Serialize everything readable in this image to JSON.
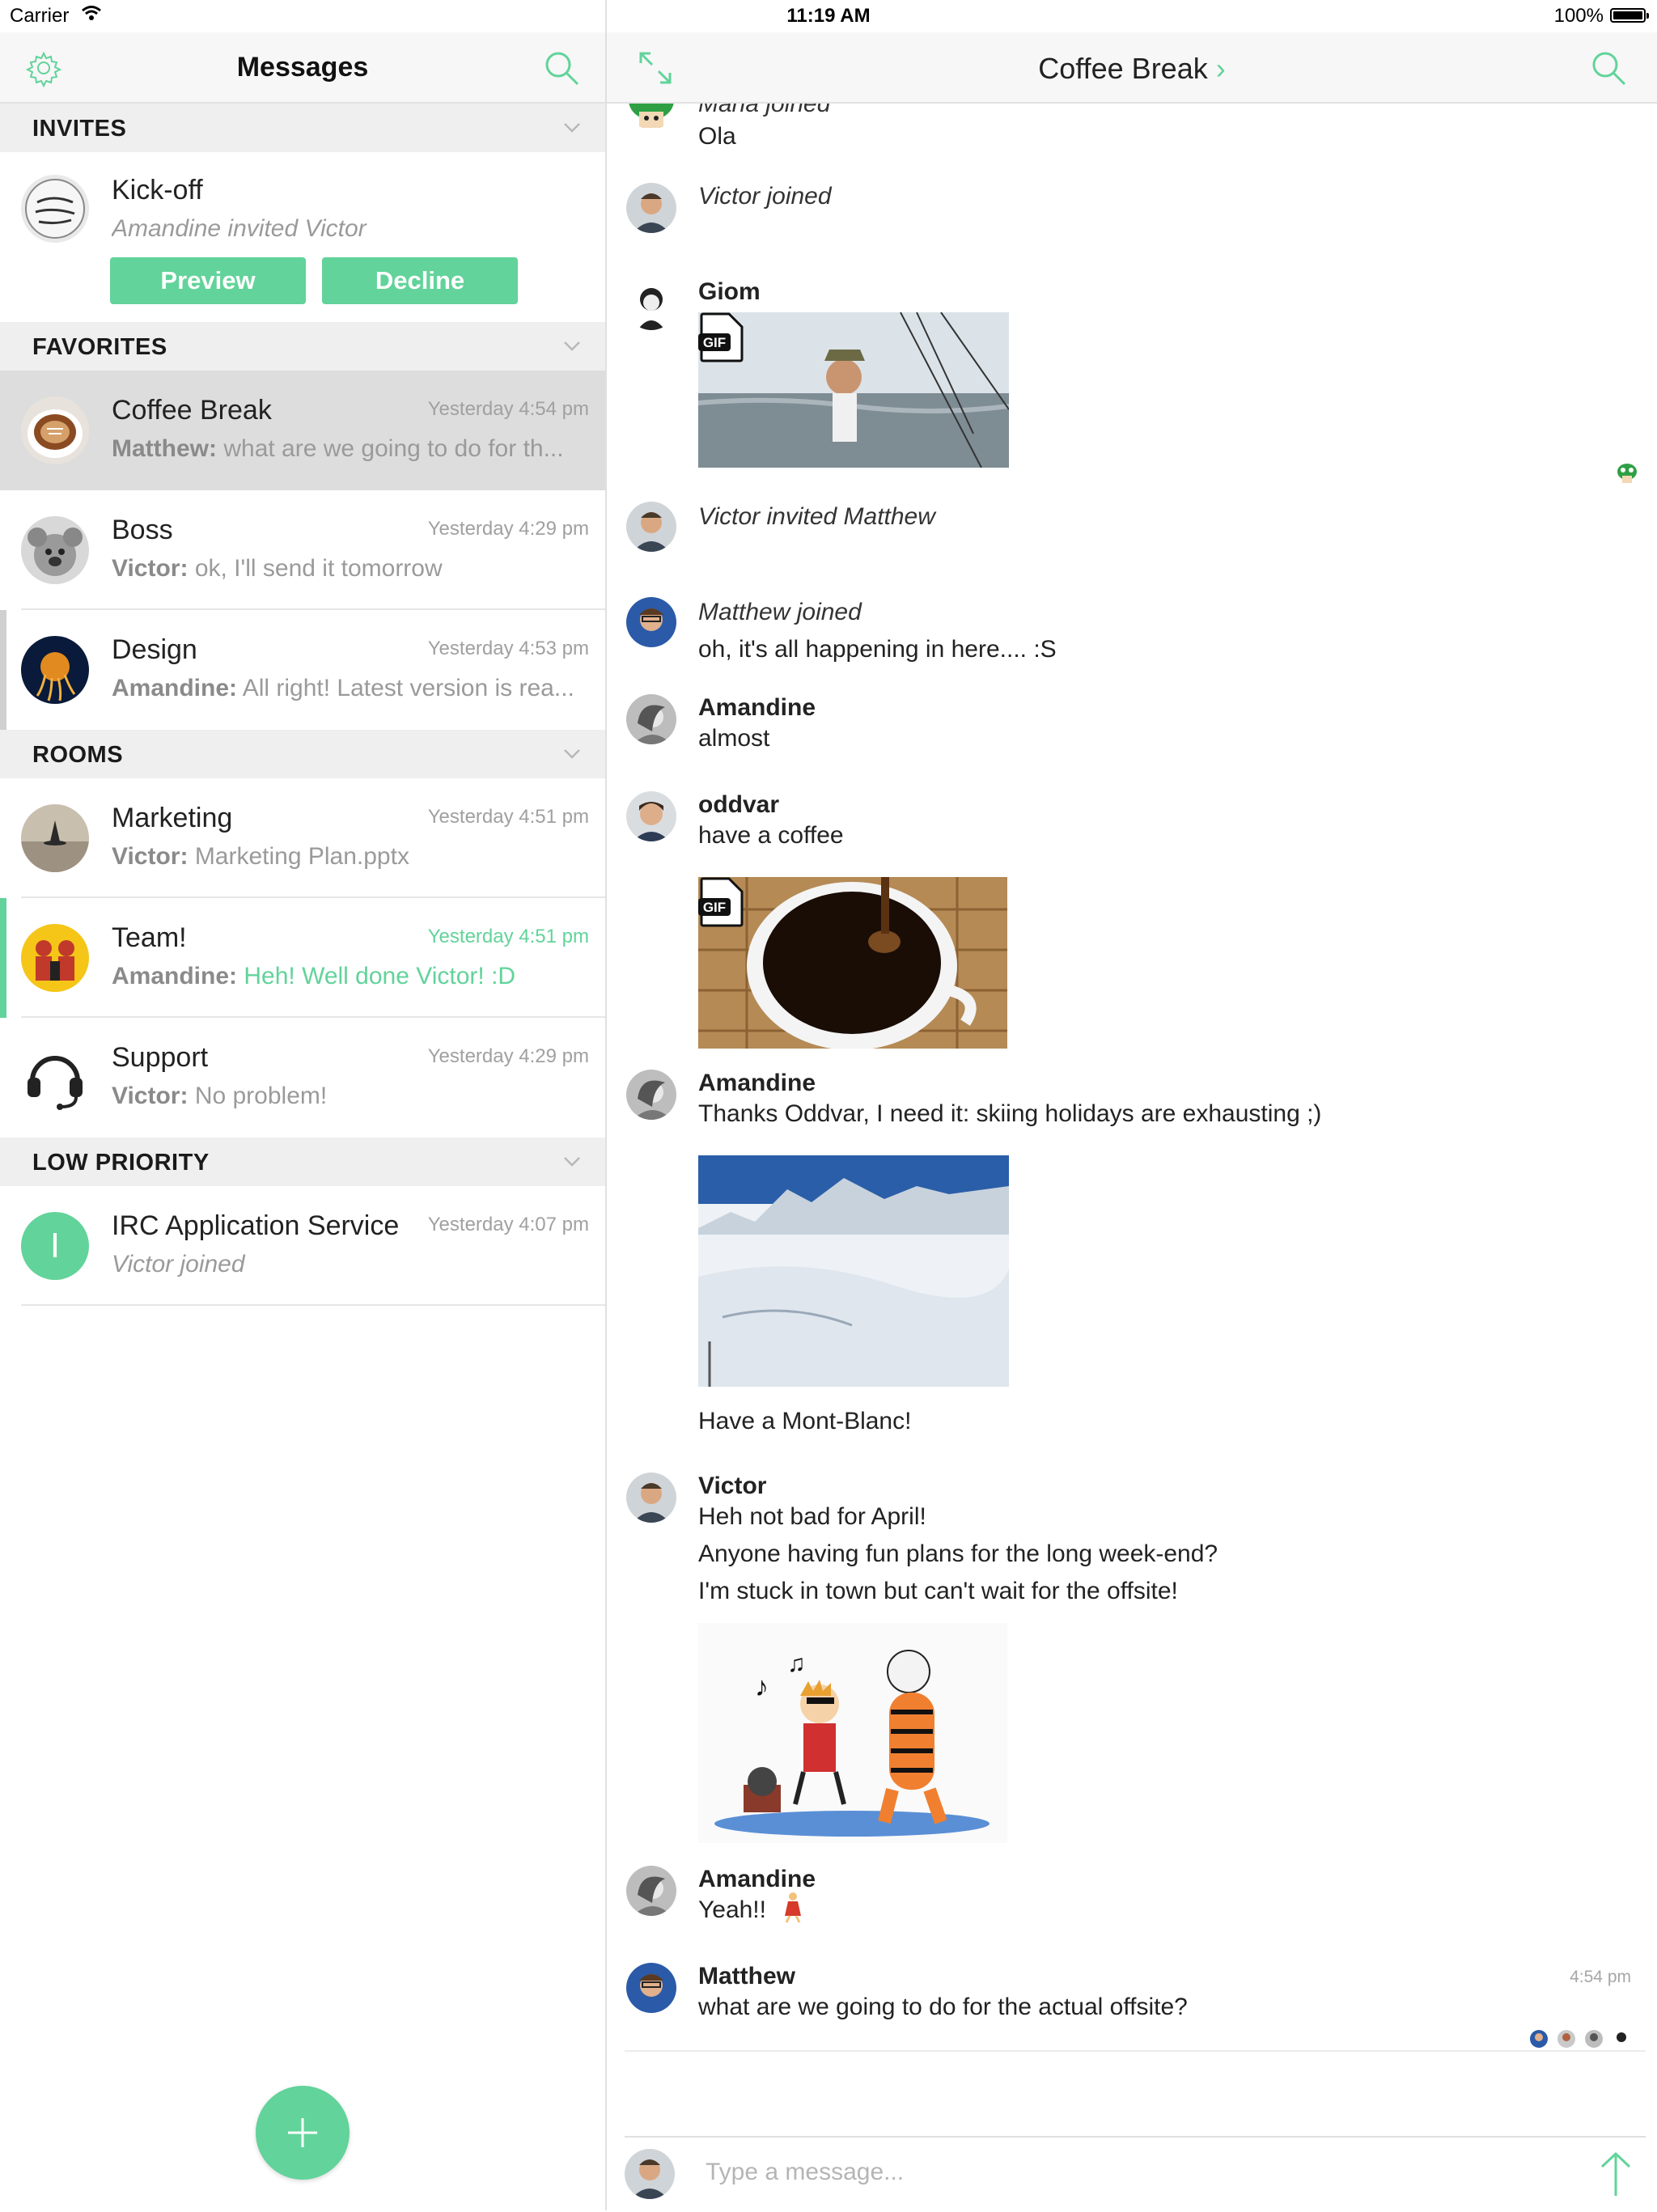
{
  "status_bar": {
    "carrier": "Carrier",
    "time": "11:19 AM",
    "battery": "100%"
  },
  "colors": {
    "accent": "#62d39a",
    "unread_marker": "#62d39a",
    "selected_row": "#dddddd"
  },
  "sidebar": {
    "title": "Messages",
    "icons": {
      "settings": "gear-icon",
      "search": "search-icon",
      "add": "plus-icon"
    },
    "sections": {
      "invites": "INVITES",
      "favorites": "FAVORITES",
      "rooms": "ROOMS",
      "low_priority": "LOW PRIORITY"
    },
    "invite": {
      "name": "Kick-off",
      "subtitle": "Amandine invited Victor",
      "preview_label": "Preview",
      "decline_label": "Decline"
    },
    "favorites": [
      {
        "name": "Coffee Break",
        "time": "Yesterday 4:54 pm",
        "sender": "Matthew:",
        "text": "what are we going to do for th..."
      },
      {
        "name": "Boss",
        "time": "Yesterday 4:29 pm",
        "sender": "Victor:",
        "text": "ok, I'll send it tomorrow"
      },
      {
        "name": "Design",
        "time": "Yesterday 4:53 pm",
        "sender": "Amandine:",
        "text": "All right! Latest version is rea..."
      }
    ],
    "rooms": [
      {
        "name": "Marketing",
        "time": "Yesterday 4:51 pm",
        "sender": "Victor:",
        "text": "Marketing Plan.pptx"
      },
      {
        "name": "Team!",
        "time": "Yesterday 4:51 pm",
        "sender": "Amandine:",
        "text": "Heh! Well done Victor! :D"
      },
      {
        "name": "Support",
        "time": "Yesterday 4:29 pm",
        "sender": "Victor:",
        "text": "No problem!"
      }
    ],
    "low_priority": [
      {
        "name": "IRC Application Service",
        "time": "Yesterday 4:07 pm",
        "text": "Victor joined",
        "avatar_letter": "I"
      }
    ]
  },
  "chat": {
    "room_title": "Coffee Break",
    "title_chevron": "›",
    "messages": {
      "partial_event": "Maria joined",
      "ola": "Ola",
      "victor_joined": "Victor joined",
      "giom_sender": "Giom",
      "gif_badge": "GIF",
      "victor_invited": "Victor invited Matthew",
      "matthew_joined": "Matthew joined",
      "happening": "oh, it's all happening in here.... :S",
      "amandine_1_sender": "Amandine",
      "amandine_1_text": "almost",
      "oddvar_sender": "oddvar",
      "oddvar_text": "have a coffee",
      "amandine_2_sender": "Amandine",
      "amandine_2_text": "Thanks Oddvar, I need it: skiing holidays are exhausting ;)",
      "montblanc_caption": "Have a Mont-Blanc!",
      "victor_sender": "Victor",
      "victor_line1": "Heh not bad for April!",
      "victor_line2": "Anyone having fun plans for the long week-end?",
      "victor_line3": "I'm stuck in town but can't wait for the offsite!",
      "amandine_3_sender": "Amandine",
      "amandine_3_text": "Yeah!!",
      "matthew_sender": "Matthew",
      "matthew_text": "what are we going to do for the actual offsite?",
      "matthew_time": "4:54 pm"
    },
    "composer": {
      "placeholder": "Type a message..."
    }
  }
}
